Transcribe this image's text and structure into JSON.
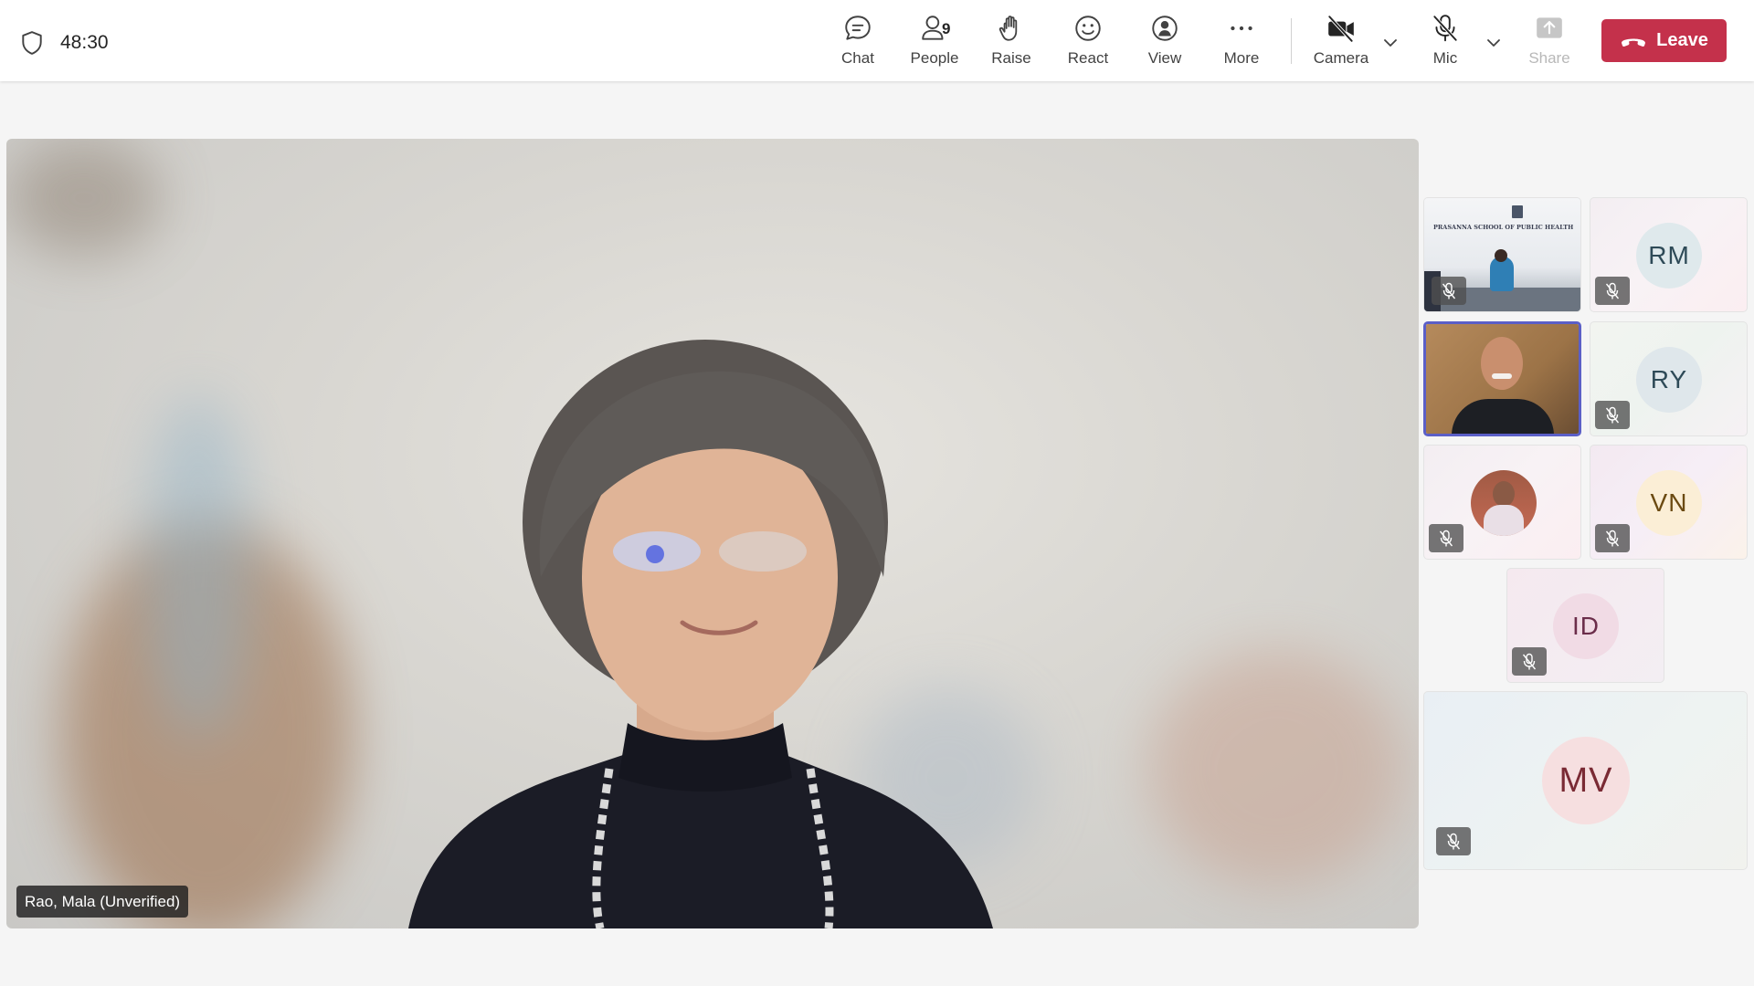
{
  "header": {
    "timer": "48:30",
    "chat_label": "Chat",
    "people_label": "People",
    "people_count": "9",
    "raise_label": "Raise",
    "react_label": "React",
    "view_label": "View",
    "more_label": "More",
    "camera_label": "Camera",
    "mic_label": "Mic",
    "share_label": "Share",
    "leave_label": "Leave"
  },
  "main_video": {
    "participant_name": "Rao, Mala (Unverified)"
  },
  "tiles": [
    {
      "kind": "video",
      "banner": "PRASANNA SCHOOL OF PUBLIC HEALTH",
      "muted": true
    },
    {
      "kind": "avatar",
      "initials": "RM",
      "muted": true
    },
    {
      "kind": "video",
      "muted": false,
      "active": true
    },
    {
      "kind": "avatar",
      "initials": "RY",
      "muted": true
    },
    {
      "kind": "photo-avatar",
      "muted": true
    },
    {
      "kind": "avatar",
      "initials": "VN",
      "muted": true
    },
    {
      "kind": "avatar",
      "initials": "ID",
      "muted": true
    },
    {
      "kind": "avatar",
      "initials": "MV",
      "muted": true
    }
  ],
  "colors": {
    "leave_bg": "#c4314b",
    "active_border": "#5b5fc7"
  }
}
